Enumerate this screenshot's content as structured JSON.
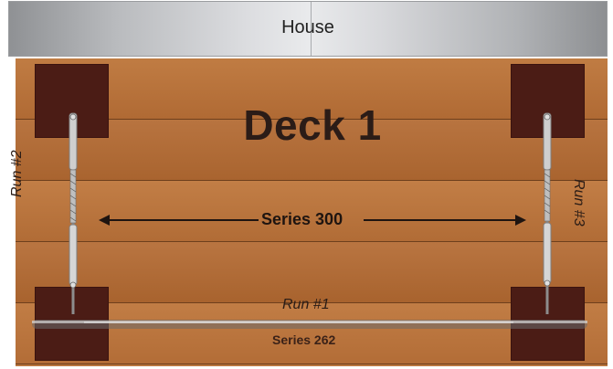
{
  "house": {
    "label": "House"
  },
  "deck": {
    "title": "Deck 1",
    "runs": [
      {
        "label": "Run #1",
        "series": "Series 262"
      },
      {
        "label": "Run #2"
      },
      {
        "label": "Run #3"
      }
    ],
    "span_label": "Series 300"
  },
  "colors": {
    "wood": "#b9763f",
    "post": "#4b1c15",
    "text_dark": "#2b1c17",
    "house_gray": "#c9cacc"
  },
  "icons": [
    "turnbuckle-icon",
    "double-arrow-icon",
    "cable-icon"
  ]
}
